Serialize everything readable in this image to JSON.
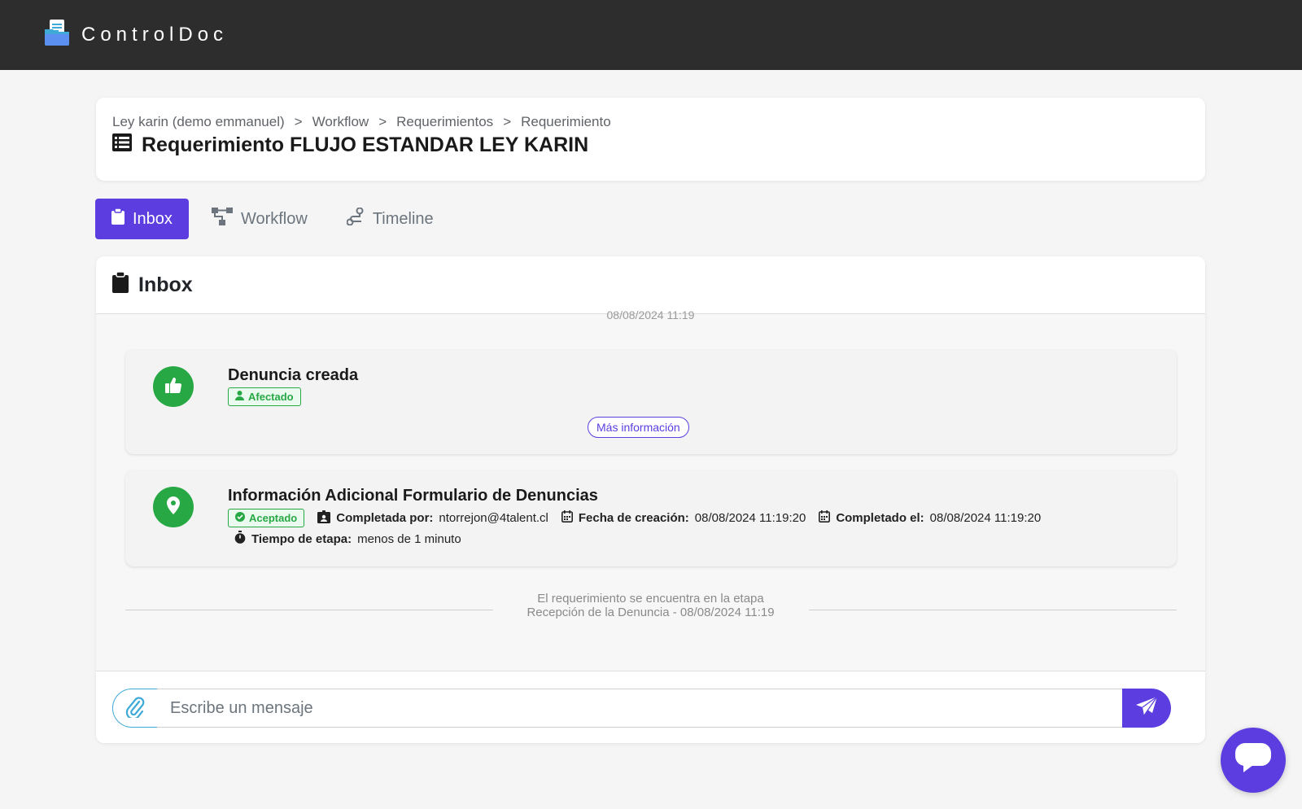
{
  "app": {
    "name": "ControlDoc"
  },
  "breadcrumb": [
    "Ley karin (demo emmanuel)",
    "Workflow",
    "Requerimientos",
    "Requerimiento"
  ],
  "breadcrumb_separator": ">",
  "page_title": "Requerimiento FLUJO ESTANDAR LEY KARIN",
  "tabs": [
    {
      "label": "Inbox",
      "icon": "clipboard-icon",
      "active": true
    },
    {
      "label": "Workflow",
      "icon": "workflow-icon",
      "active": false
    },
    {
      "label": "Timeline",
      "icon": "timeline-icon",
      "active": false
    }
  ],
  "inbox": {
    "title": "Inbox",
    "clipped_date": "08/08/2024 11:19",
    "events": [
      {
        "title": "Denuncia creada",
        "icon": "thumbs-up-icon",
        "badge": "Afectado",
        "more_info": "Más información"
      },
      {
        "title": "Información Adicional Formulario de Denuncias",
        "icon": "map-pin-icon",
        "badge": "Aceptado",
        "completed_by_label": "Completada por:",
        "completed_by": "ntorrejon@4talent.cl",
        "created_label": "Fecha de creación:",
        "created": "08/08/2024 11:19:20",
        "completed_label": "Completado el:",
        "completed": "08/08/2024 11:19:20",
        "stage_time_label": "Tiempo de etapa:",
        "stage_time": "menos de 1 minuto"
      }
    ],
    "stage_line1": "El requerimiento se encuentra en la etapa",
    "stage_line2": "Recepción de la Denuncia - 08/08/2024 11:19"
  },
  "composer": {
    "placeholder": "Escribe un mensaje"
  },
  "colors": {
    "primary": "#5b3de0",
    "success": "#27a844",
    "topbar": "#2d2d2d",
    "attach": "#3fa9d8"
  }
}
